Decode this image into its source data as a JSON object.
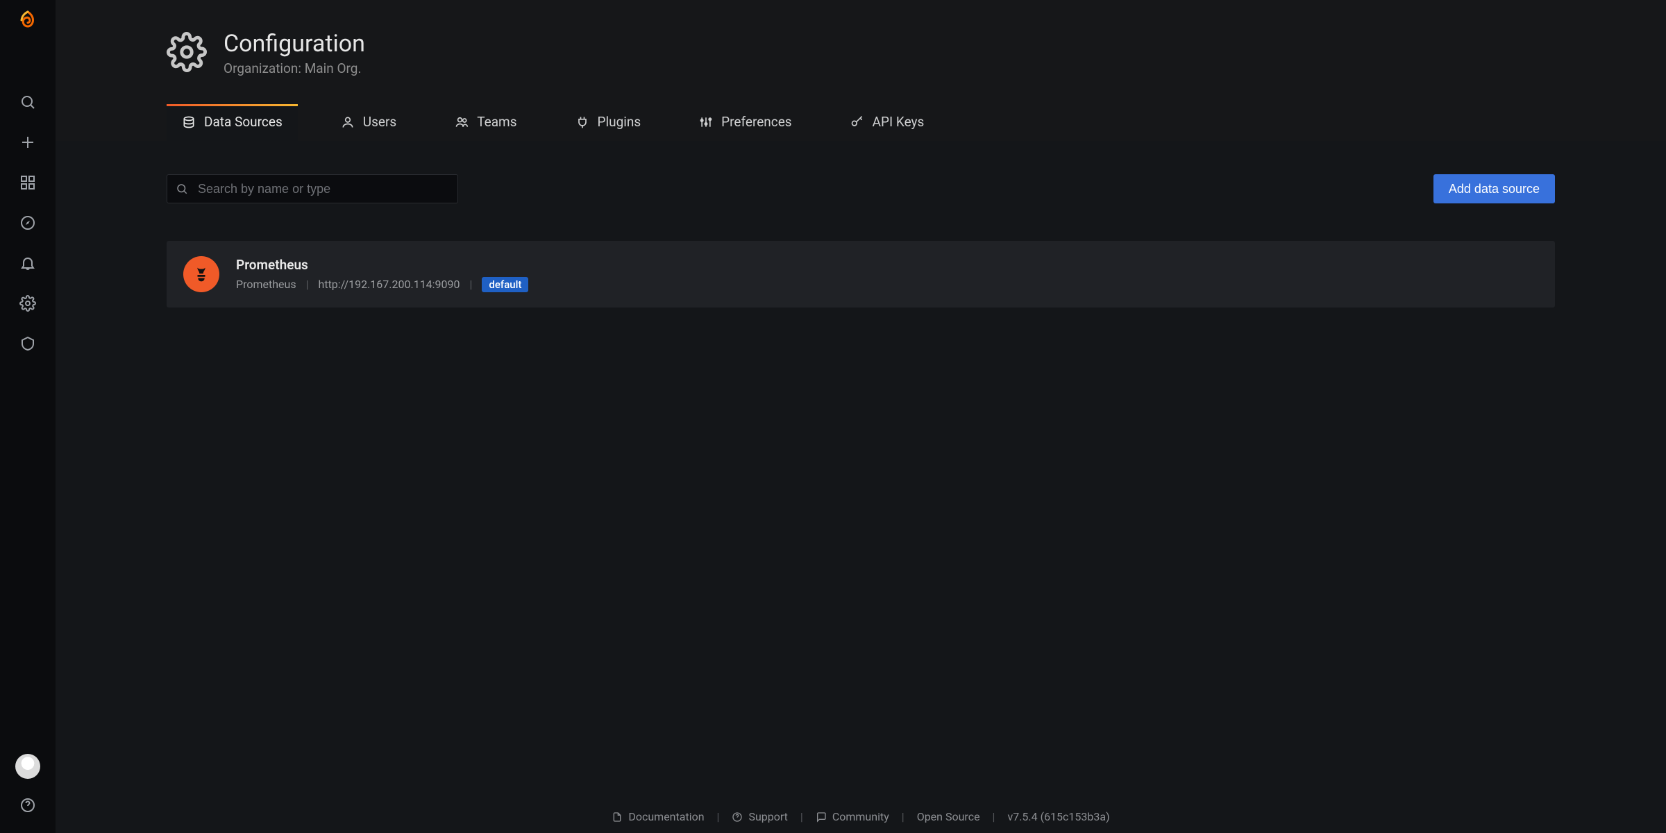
{
  "header": {
    "title": "Configuration",
    "subtitle": "Organization: Main Org."
  },
  "tabs": [
    {
      "label": "Data Sources"
    },
    {
      "label": "Users"
    },
    {
      "label": "Teams"
    },
    {
      "label": "Plugins"
    },
    {
      "label": "Preferences"
    },
    {
      "label": "API Keys"
    }
  ],
  "search": {
    "placeholder": "Search by name or type"
  },
  "buttons": {
    "add_data_source": "Add data source"
  },
  "datasources": [
    {
      "name": "Prometheus",
      "type": "Prometheus",
      "url": "http://192.167.200.114:9090",
      "badge": "default"
    }
  ],
  "footer": {
    "documentation": "Documentation",
    "support": "Support",
    "community": "Community",
    "open_source": "Open Source",
    "version": "v7.5.4 (615c153b3a)"
  }
}
